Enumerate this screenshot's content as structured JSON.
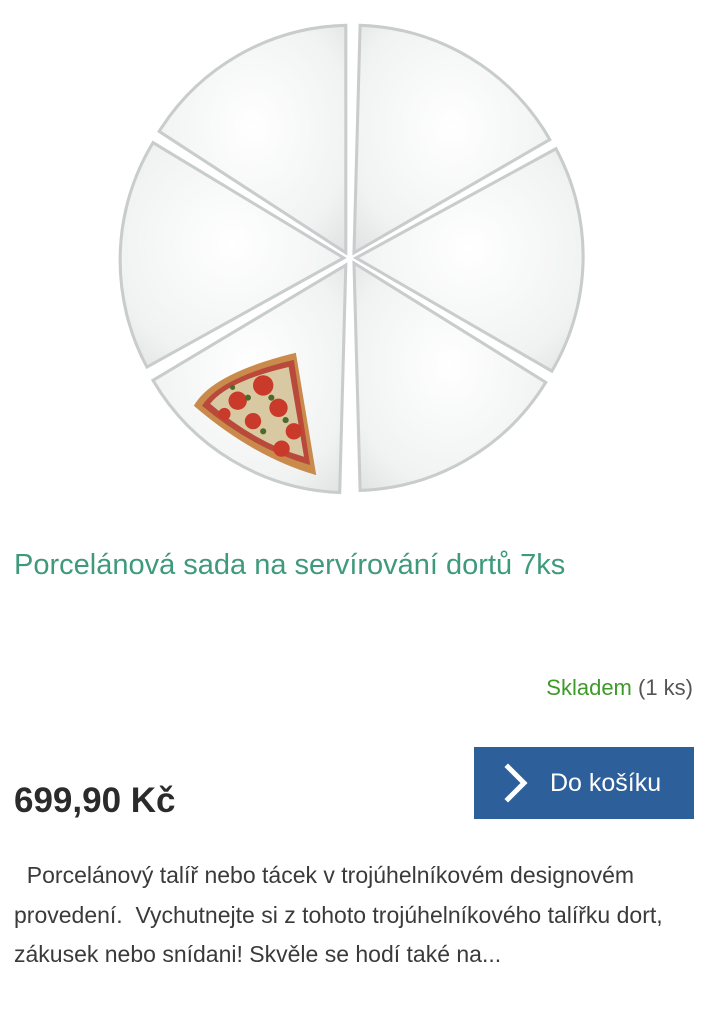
{
  "product": {
    "image_icon": "triangle-plates-with-pizza-slice",
    "title": "Porcelánová sada na servírování dortů 7ks",
    "availability": {
      "status": "Skladem",
      "quantity": " (1 ks)"
    },
    "price": "699,90 Kč",
    "cart_button": {
      "icon": "chevron-right-icon",
      "label": "Do košíku"
    },
    "description": "  Porcelánový talíř nebo tácek v trojúhelníkovém designovém provedení.  Vychutnejte si z tohoto trojúhelníkového talířku dort, zákusek nebo snídani! Skvěle se hodí také na..."
  },
  "colors": {
    "title": "#3f9a7c",
    "in_stock": "#3e9a28",
    "button": "#2d5f9a",
    "price": "#2b2b2b"
  }
}
